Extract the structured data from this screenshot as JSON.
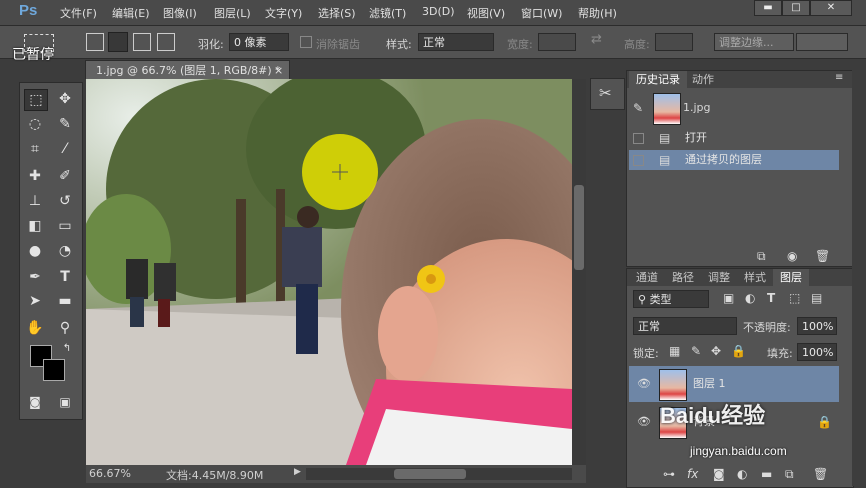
{
  "app": {
    "logo": "Ps",
    "paused_label": "已暂停"
  },
  "menu": [
    "文件(F)",
    "编辑(E)",
    "图像(I)",
    "图层(L)",
    "文字(Y)",
    "选择(S)",
    "滤镜(T)",
    "3D(D)",
    "视图(V)",
    "窗口(W)",
    "帮助(H)"
  ],
  "window_controls": {
    "minimize": "▬",
    "maximize": "□",
    "close": "✕"
  },
  "options": {
    "feather_label": "羽化:",
    "feather_value": "0 像素",
    "antialias_label": "消除锯齿",
    "style_label": "样式:",
    "style_value": "正常",
    "width_label": "宽度:",
    "height_label": "高度:",
    "refine_edge": "调整边缘..."
  },
  "document": {
    "tab_title": "1.jpg @ 66.7% (图层 1, RGB/8#) *",
    "zoom": "66.67%",
    "doc_size": "文档:4.45M/8.90M"
  },
  "history": {
    "tabs": [
      "历史记录",
      "动作"
    ],
    "snapshot": "1.jpg",
    "items": [
      "打开",
      "通过拷贝的图层"
    ]
  },
  "layers": {
    "tabs": [
      "通道",
      "路径",
      "调整",
      "样式",
      "图层"
    ],
    "filter": "类型",
    "blend_mode": "正常",
    "opacity_label": "不透明度:",
    "opacity_value": "100%",
    "lock_label": "锁定:",
    "fill_label": "填充:",
    "fill_value": "100%",
    "rows": [
      "图层 1",
      "背景"
    ]
  },
  "watermark": {
    "brand": "Baidu经验",
    "url": "jingyan.baidu.com"
  },
  "colors": {
    "selection_blue": "#6e86a6",
    "highlight_yellow": "#e6e200",
    "ps_blue": "#6fa8dc"
  }
}
